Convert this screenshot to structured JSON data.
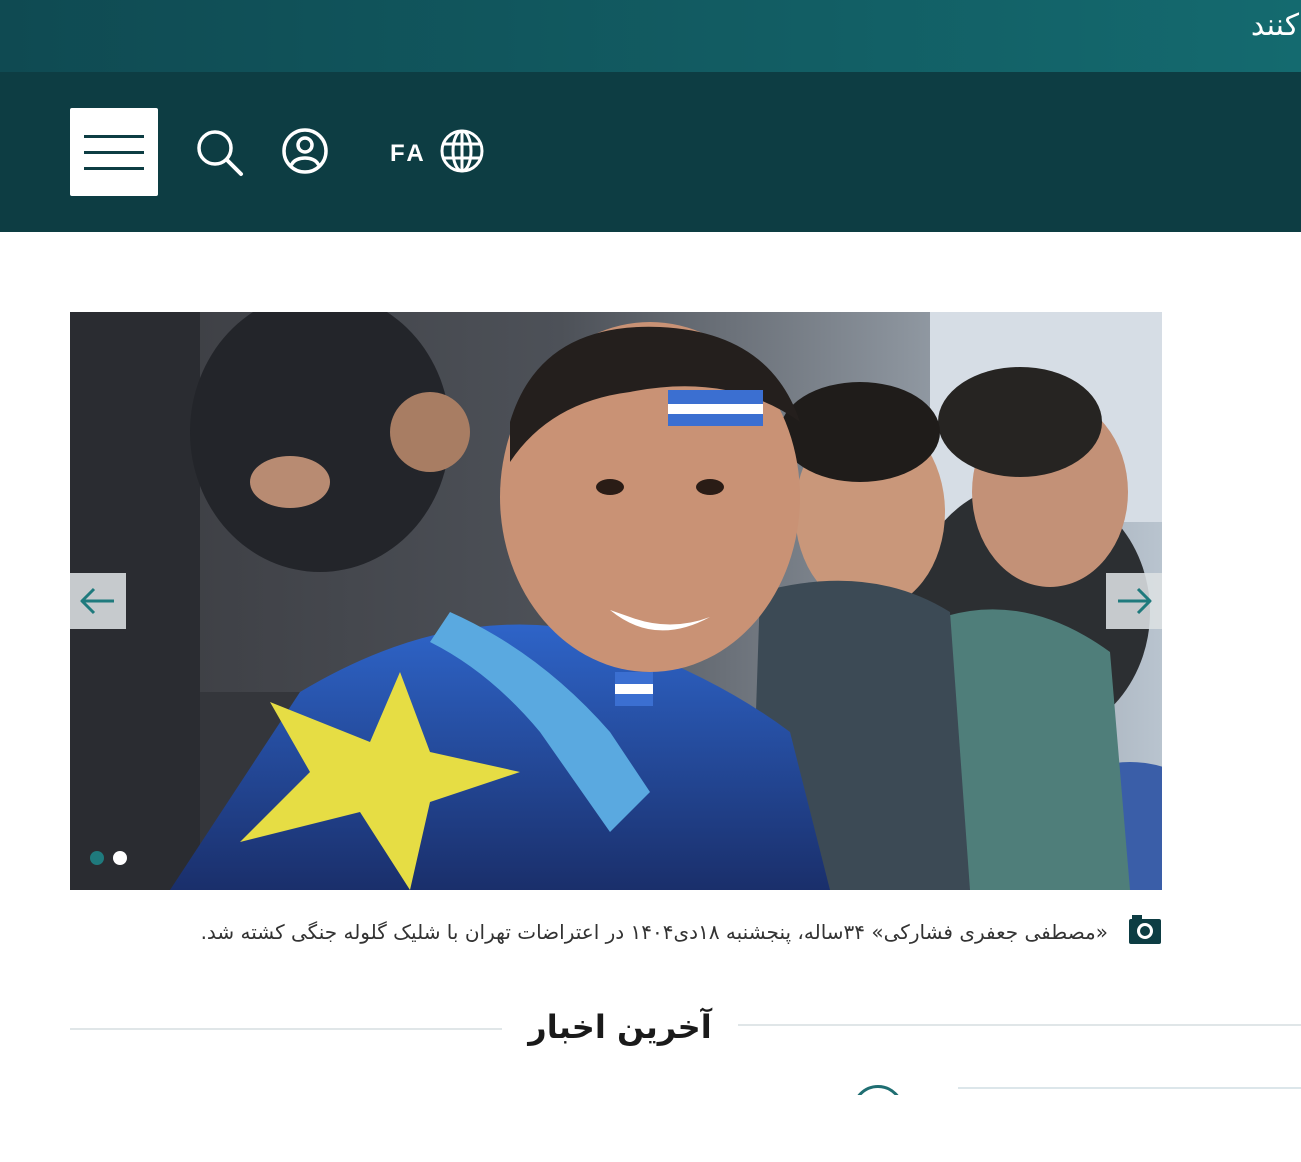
{
  "top_banner": {
    "text": "کنند"
  },
  "header": {
    "language_code": "FA",
    "icons": {
      "menu": "hamburger-menu-icon",
      "search": "search-icon",
      "account": "user-icon",
      "language": "globe-icon"
    }
  },
  "colors": {
    "banner": "#146a6f",
    "header_bg": "#0d3d43",
    "accent": "#1f7a7d",
    "white": "#ffffff"
  },
  "slider": {
    "slide_count": 2,
    "active_slide": 1,
    "prev_icon": "arrow-left-icon",
    "next_icon": "arrow-right-icon"
  },
  "caption": {
    "icon": "camera-icon",
    "text": "«مصطفی جعفری فشارکی» ۳۴ساله، پنجشنبه ۱۸دی۱۴۰۴ در اعتراضات تهران با شلیک گلوله جنگی کشته شد."
  },
  "latest_news": {
    "title": "آخرین اخبار"
  }
}
